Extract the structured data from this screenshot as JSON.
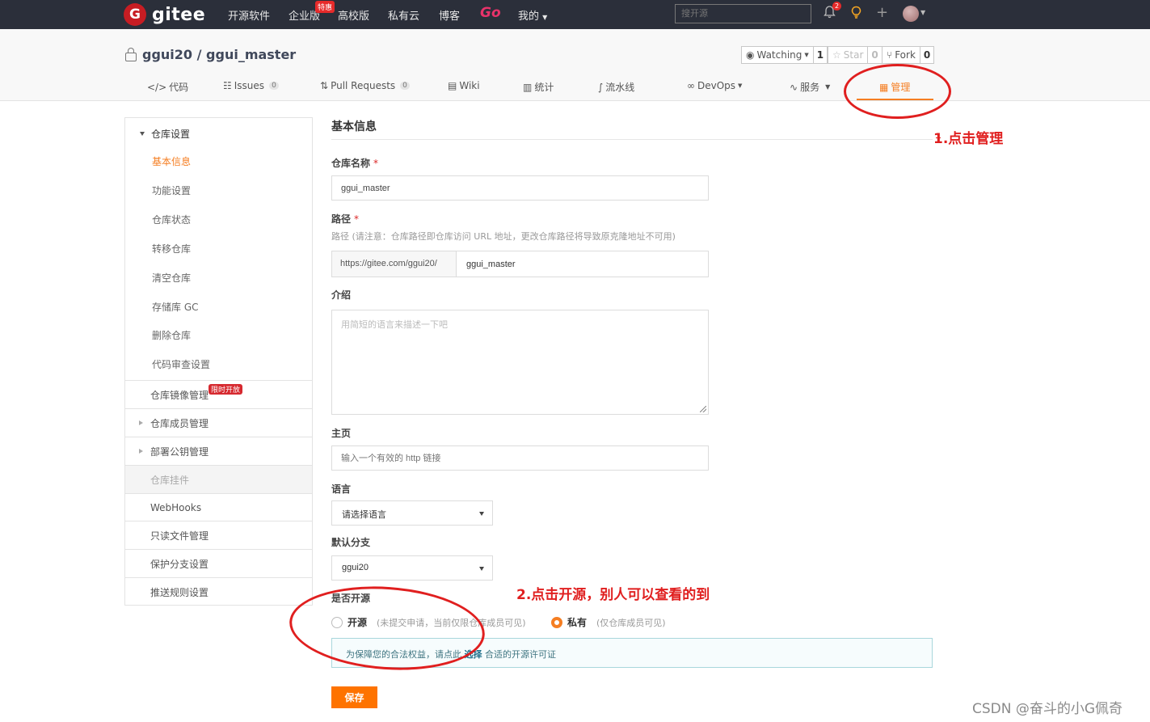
{
  "topnav": {
    "logo_letter": "G",
    "logo_text": "gitee",
    "items": [
      "开源软件",
      "企业版",
      "高校版",
      "私有云",
      "博客",
      "Go",
      "我的"
    ],
    "enterprise_badge": "特惠",
    "search_placeholder": "搜开源",
    "notification_count": "2",
    "icons": [
      "bell-icon",
      "lightbulb-icon",
      "plus-icon",
      "avatar"
    ]
  },
  "repo": {
    "title": "ggui20 / ggui_master",
    "watching_label": "Watching",
    "watching_count": "1",
    "star_label": "Star",
    "star_count": "0",
    "fork_label": "Fork",
    "fork_count": "0"
  },
  "tabs": [
    {
      "icon": "</>",
      "label": "代码"
    },
    {
      "icon": "☷",
      "label": "Issues",
      "count": "0"
    },
    {
      "icon": "⇅",
      "label": "Pull Requests",
      "count": "0"
    },
    {
      "icon": "▤",
      "label": "Wiki"
    },
    {
      "icon": "▥",
      "label": "统计"
    },
    {
      "icon": "∫",
      "label": "流水线"
    },
    {
      "icon": "∞",
      "label": "DevOps"
    },
    {
      "icon": "∿",
      "label": "服务"
    },
    {
      "icon": "▦",
      "label": "管理",
      "active": true
    }
  ],
  "sidebar": {
    "section_title": "仓库设置",
    "sub_items": [
      "基本信息",
      "功能设置",
      "仓库状态",
      "转移仓库",
      "清空仓库",
      "存储库 GC",
      "删除仓库",
      "代码审查设置"
    ],
    "groups": [
      "仓库镜像管理",
      "仓库成员管理",
      "部署公钥管理",
      "仓库挂件",
      "WebHooks",
      "只读文件管理",
      "保护分支设置",
      "推送规则设置"
    ],
    "mirror_badge": "限时开放"
  },
  "form": {
    "title": "基本信息",
    "name_label": "仓库名称",
    "name_value": "ggui_master",
    "path_label": "路径",
    "path_hint": "路径 (请注意：仓库路径即仓库访问 URL 地址，更改仓库路径将导致原克隆地址不可用)",
    "path_prefix": "https://gitee.com/ggui20/",
    "path_value": "ggui_master",
    "intro_label": "介绍",
    "intro_placeholder": "用简短的语言来描述一下吧",
    "homepage_label": "主页",
    "homepage_placeholder": "输入一个有效的 http 链接",
    "language_label": "语言",
    "language_value": "请选择语言",
    "branch_label": "默认分支",
    "branch_value": "ggui20",
    "opensource_label": "是否开源",
    "open_label": "开源",
    "open_note": "(未提交申请，当前仅限仓库成员可见)",
    "private_label": "私有",
    "private_note": "(仅仓库成员可见)",
    "notice_before": "为保障您的合法权益，请点此",
    "notice_link": "选择",
    "notice_after": "合适的开源许可证",
    "save_label": "保存"
  },
  "annotations": {
    "step1": "1.点击管理",
    "step2": "2.点击开源，别人可以查看的到"
  },
  "watermark": "CSDN @奋斗的小G佩奇",
  "colors": {
    "accent": "#f57e22",
    "nav_bg": "#2b2f3a",
    "annotation": "#e01f1f",
    "logo": "#c71d23"
  }
}
